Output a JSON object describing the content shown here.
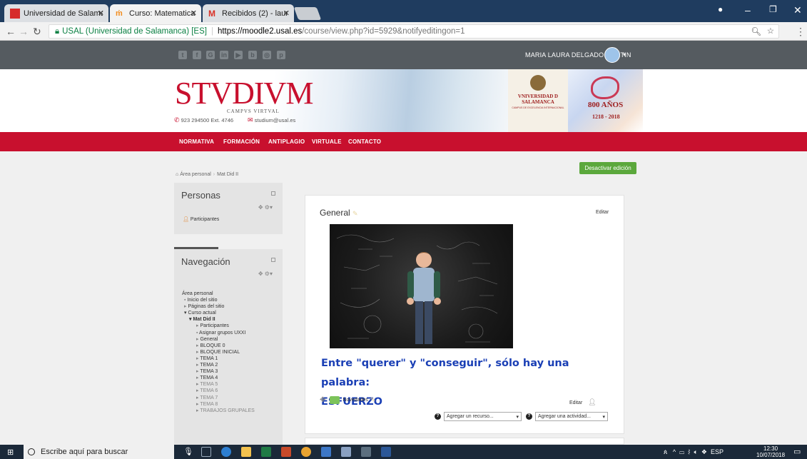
{
  "browser": {
    "tabs": [
      {
        "title": "Universidad de Salamanc",
        "active": false,
        "icon": "usal-red-icon"
      },
      {
        "title": "Curso: Matematicas y su",
        "active": true,
        "icon": "moodle-hat-icon"
      },
      {
        "title": "Recibidos (2) - laura@usa",
        "active": false,
        "icon": "gmail-icon"
      }
    ],
    "address": {
      "security": "USAL (Universidad de Salamanca) [ES]",
      "host": "https://moodle2.usal.es",
      "path": "/course/view.php?id=5929&notifyeditingon=1"
    }
  },
  "site": {
    "social_icons": [
      "twitter-icon",
      "facebook-icon",
      "google-plus-icon",
      "linkedin-icon",
      "youtube-icon",
      "blog-icon",
      "instagram-icon",
      "pinterest-icon"
    ],
    "user_name": "MARIA LAURA DELGADO MARTIN",
    "logo": {
      "main": "STVDIVM",
      "sub": "CAMPVS VIRTVAL"
    },
    "phone": "923 294500 Ext. 4746",
    "email": "studium@usal.es",
    "usal": {
      "name": "VNIVERSIDAD D SALAMANCA",
      "tagline": "CAMPUS DE EXCELENCIA INTERNACIONAL"
    },
    "anniversary": {
      "title": "800 AÑOS",
      "years": "1218 - 2018"
    },
    "nav": [
      "NORMATIVA",
      "FORMACIÓN",
      "ANTIPLAGIO",
      "VIRTUALE",
      "CONTACTO"
    ]
  },
  "page": {
    "toggle_edit": "Desactivar edición",
    "breadcrumb": [
      "Área personal",
      "Mat Did II"
    ],
    "personas_block": {
      "title": "Personas",
      "items": [
        "Participantes"
      ]
    },
    "nav_block": {
      "title": "Navegación",
      "tree": [
        "Área personal",
        "Inicio del sitio",
        "Páginas del sitio",
        "Curso actual",
        "Mat Did II",
        "Participantes",
        "Asignar grupos UXXI",
        "General",
        "BLOQUE 0",
        "BLOQUE INICIAL",
        "TEMA 1",
        "TEMA 2",
        "TEMA 3",
        "TEMA 4",
        "TEMA 5",
        "TEMA 6",
        "TEMA 7",
        "TEMA 8",
        "TRABAJOS GRUPALES"
      ]
    },
    "section": {
      "name": "General",
      "edit": "Editar",
      "headline_line1": "Entre \"querer\" y \"conseguir\", sólo hay una palabra:",
      "headline_line2": "ESFUERZO",
      "forum": "Novedades",
      "forum_edit": "Editar",
      "add_resource": "Agregar un recurso...",
      "add_activity": "Agregar una actividad..."
    }
  },
  "taskbar": {
    "search_placeholder": "Escribe aquí para buscar",
    "language": "ESP",
    "time": "12:30",
    "date": "10/07/2018"
  }
}
